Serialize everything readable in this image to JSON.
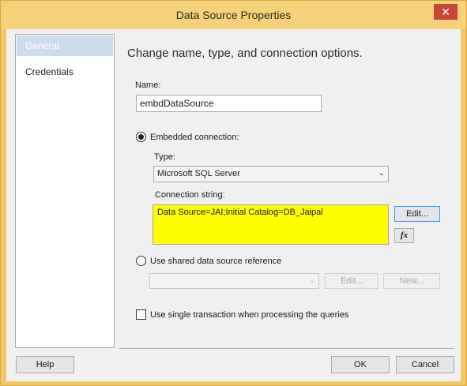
{
  "window": {
    "title": "Data Source Properties",
    "close_glyph": "✕"
  },
  "nav": {
    "items": [
      {
        "label": "General"
      },
      {
        "label": "Credentials"
      }
    ]
  },
  "main": {
    "heading": "Change name, type, and connection options.",
    "name_label": "Name:",
    "name_value": "embdDataSource",
    "embedded_label": "Embedded connection:",
    "type_label": "Type:",
    "type_value": "Microsoft SQL Server",
    "connstring_label": "Connection string:",
    "connstring_value": "Data Source=JAI;Initial Catalog=DB_Jaipal",
    "edit_label": "Edit...",
    "fx_label": "fx",
    "shared_label": "Use shared data source reference",
    "shared_value": "",
    "shared_edit_label": "Edit...",
    "shared_new_label": "New...",
    "single_txn_label": "Use single transaction when processing the queries"
  },
  "footer": {
    "help_label": "Help",
    "ok_label": "OK",
    "cancel_label": "Cancel"
  },
  "state": {
    "embedded_selected": true,
    "shared_selected": false,
    "single_txn_checked": false
  }
}
